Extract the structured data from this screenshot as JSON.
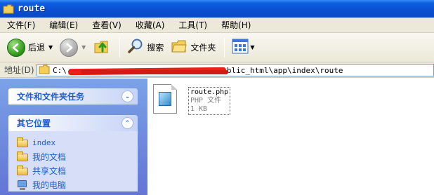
{
  "window": {
    "title": "route"
  },
  "menu": [
    "文件(F)",
    "编辑(E)",
    "查看(V)",
    "收藏(A)",
    "工具(T)",
    "帮助(H)"
  ],
  "toolbar": {
    "back_label": "后退",
    "search_label": "搜索",
    "folders_label": "文件夹"
  },
  "address": {
    "label": "地址(D)",
    "path_start": "C:\\",
    "path_end": "blic_html\\app\\index\\route"
  },
  "tasks_panel": {
    "title": "文件和文件夹任务"
  },
  "places_panel": {
    "title": "其它位置",
    "items": [
      {
        "label": "index",
        "icon": "folder-icon"
      },
      {
        "label": "我的文档",
        "icon": "folder-icon"
      },
      {
        "label": "共享文档",
        "icon": "folder-icon"
      },
      {
        "label": "我的电脑",
        "icon": "computer-icon"
      }
    ]
  },
  "files": [
    {
      "name": "route.php",
      "type": "PHP 文件",
      "size": "1 KB"
    }
  ],
  "colors": {
    "titlebar": "#0a4fd0",
    "taskpane": "#6f8fe0",
    "panel_link": "#215dc6"
  }
}
